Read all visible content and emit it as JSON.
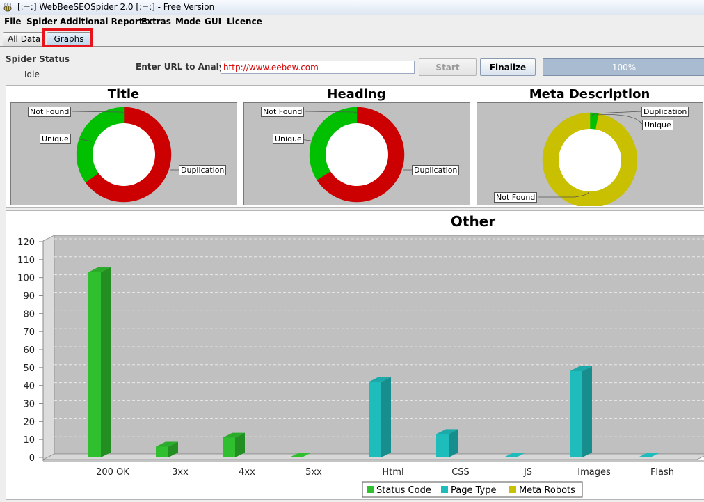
{
  "window": {
    "title": "[:=:] WebBeeSEOSpider 2.0 [:=:]  -  Free Version"
  },
  "menu": [
    "File",
    "Spider",
    "Additional Reports",
    "Extras",
    "Mode",
    "GUI",
    "Licence"
  ],
  "tabs": [
    {
      "label": "All Data",
      "active": false
    },
    {
      "label": "Graphs",
      "active": true
    }
  ],
  "status": {
    "label": "Spider Status",
    "value": "Idle"
  },
  "url": {
    "label": "Enter URL to Analyse",
    "value": "http://www.eebew.com"
  },
  "buttons": {
    "start": "Start",
    "finalize": "Finalize"
  },
  "progress": {
    "text": "100%",
    "value": 1.0
  },
  "colors": {
    "green": "#00c000",
    "red": "#cc0000",
    "olive": "#c8c000",
    "teal": "#1fbcbc",
    "highlight": "#e8141b"
  },
  "pies": [
    {
      "title": "Title",
      "labels": {
        "not_found": "Not Found",
        "unique": "Unique",
        "duplication": "Duplication"
      }
    },
    {
      "title": "Heading",
      "labels": {
        "not_found": "Not Found",
        "unique": "Unique",
        "duplication": "Duplication"
      }
    },
    {
      "title": "Meta Description",
      "labels": {
        "not_found": "Not Found",
        "unique": "Unique",
        "duplication": "Duplication"
      }
    }
  ],
  "chart_data": [
    {
      "type": "pie",
      "title": "Title",
      "slices": [
        {
          "label": "Not Found",
          "value": 0,
          "color": "#00c000"
        },
        {
          "label": "Duplication",
          "value": 65,
          "color": "#cc0000"
        },
        {
          "label": "Unique",
          "value": 35,
          "color": "#00c000"
        }
      ]
    },
    {
      "type": "pie",
      "title": "Heading",
      "slices": [
        {
          "label": "Not Found",
          "value": 0,
          "color": "#00c000"
        },
        {
          "label": "Duplication",
          "value": 66,
          "color": "#cc0000"
        },
        {
          "label": "Unique",
          "value": 34,
          "color": "#00c000"
        }
      ]
    },
    {
      "type": "pie",
      "title": "Meta Description",
      "slices": [
        {
          "label": "Duplication",
          "value": 1,
          "color": "#00c000"
        },
        {
          "label": "Unique",
          "value": 2,
          "color": "#00c000"
        },
        {
          "label": "Not Found",
          "value": 97,
          "color": "#c8c000"
        }
      ]
    },
    {
      "type": "bar",
      "title": "Other",
      "categories": [
        "200 OK",
        "3xx",
        "4xx",
        "5xx",
        "Html",
        "CSS",
        "JS",
        "Images",
        "Flash"
      ],
      "series": [
        {
          "name": "Status Code",
          "color": "#2fbf2f",
          "values": [
            103,
            6,
            11,
            0,
            null,
            null,
            null,
            null,
            null
          ]
        },
        {
          "name": "Page Type",
          "color": "#1fbcbc",
          "values": [
            null,
            null,
            null,
            null,
            42,
            13,
            0,
            48,
            0
          ]
        },
        {
          "name": "Meta Robots",
          "color": "#c8c000",
          "values": [
            null,
            null,
            null,
            null,
            null,
            null,
            null,
            null,
            null
          ]
        }
      ],
      "yticks": [
        0,
        10,
        20,
        30,
        40,
        50,
        60,
        70,
        80,
        90,
        100,
        110,
        120
      ],
      "ylim": [
        0,
        120
      ],
      "grid": true,
      "legend": "bottom"
    }
  ]
}
